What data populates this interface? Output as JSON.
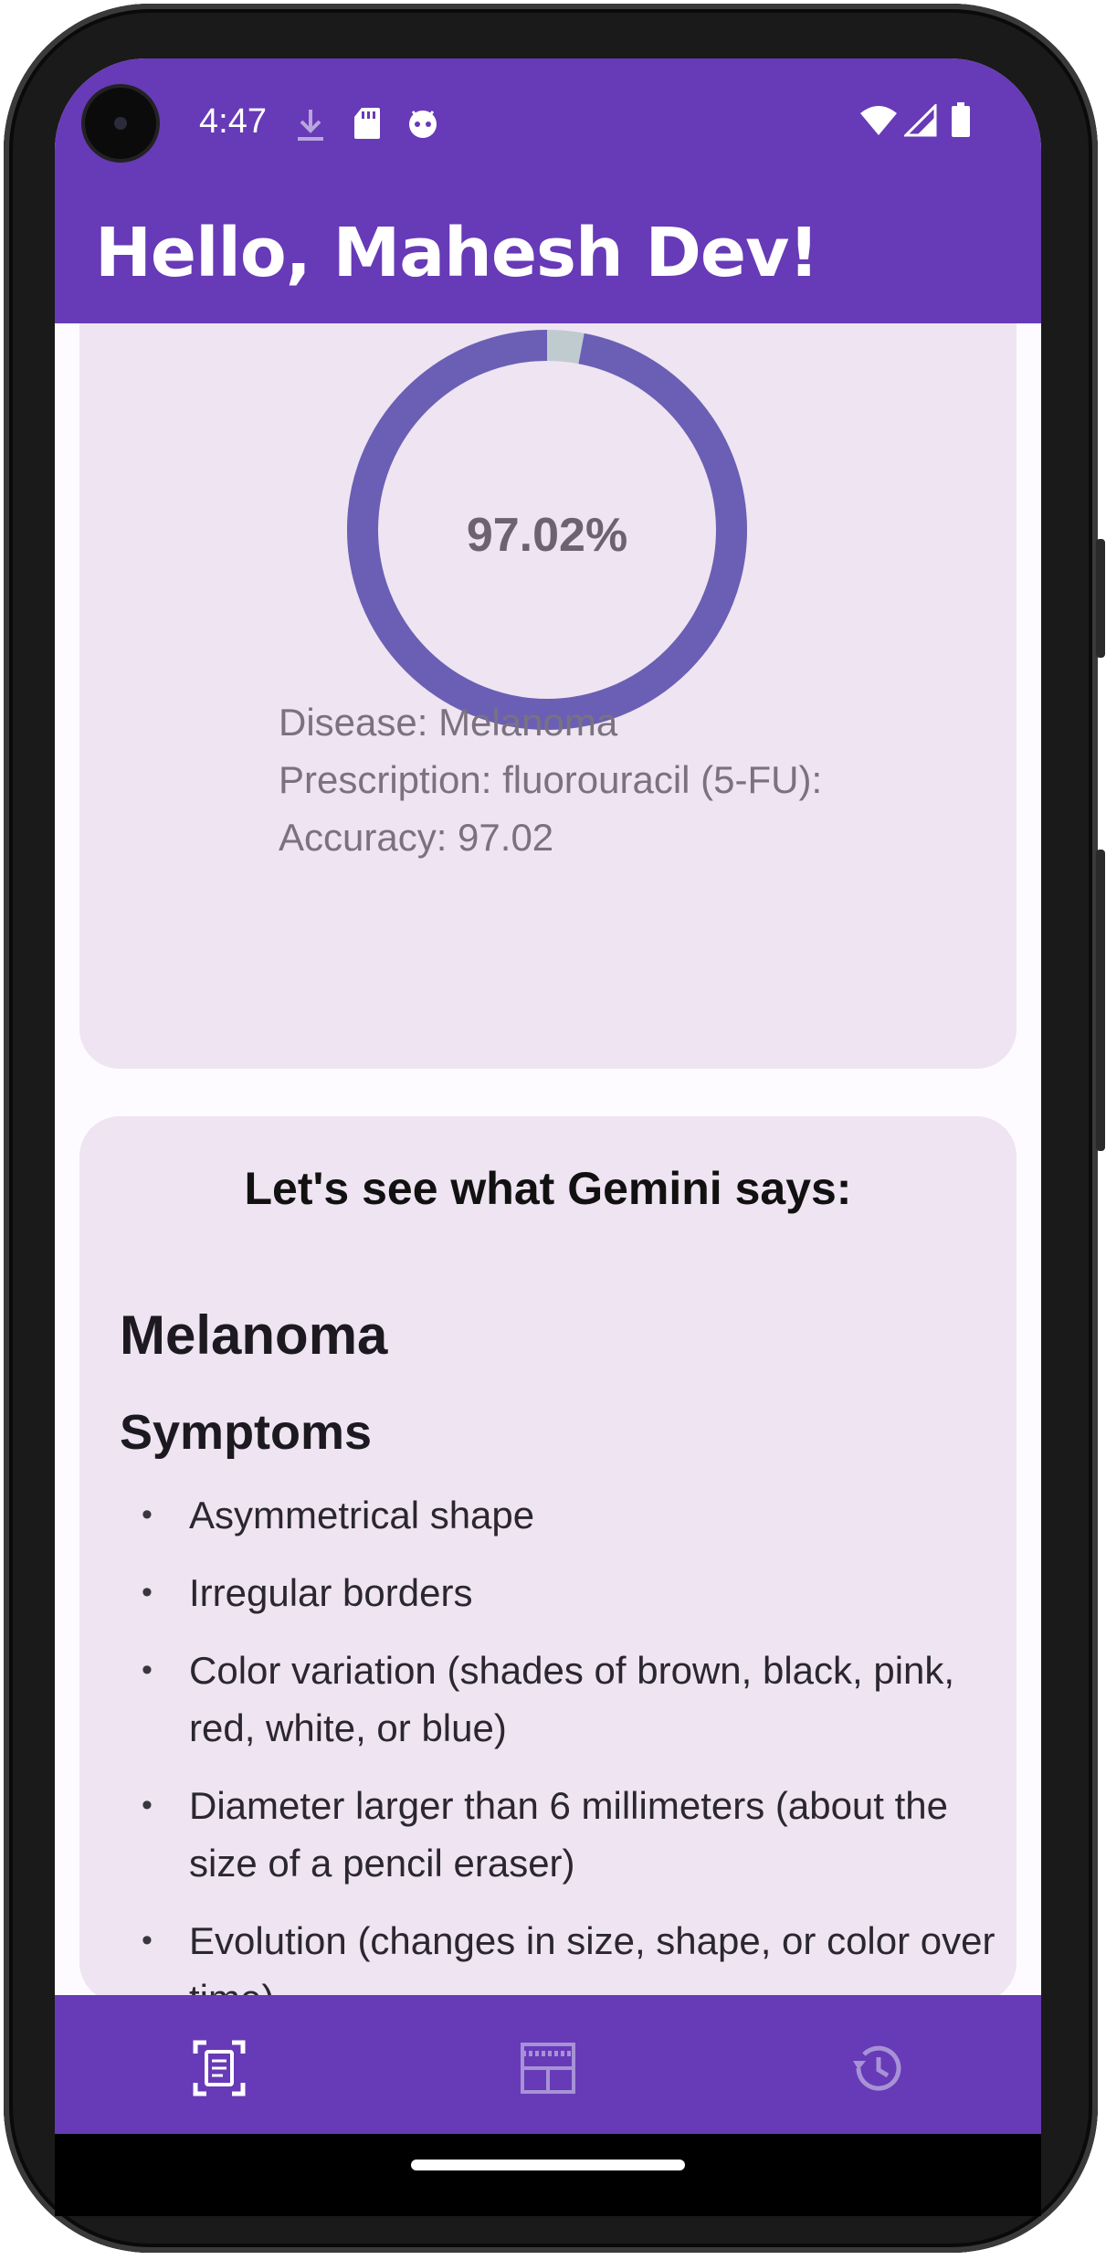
{
  "status_bar": {
    "time": "4:47",
    "icons": [
      "download-icon",
      "sd-card-icon",
      "android-debug-icon",
      "wifi-icon",
      "signal-icon",
      "battery-icon"
    ]
  },
  "appbar": {
    "title": "Hello, Mahesh Dev!"
  },
  "result_card": {
    "ring_percent_label": "97.02%",
    "ring_fill_percent": 97.02,
    "disease_line": "Disease: Melanoma",
    "prescription_line": "Prescription: fluorouracil (5-FU):",
    "accuracy_line": "Accuracy: 97.02"
  },
  "gemini_card": {
    "title": "Let's see what Gemini says:",
    "heading": "Melanoma",
    "subheading": "Symptoms",
    "symptoms": [
      "Asymmetrical shape",
      "Irregular borders",
      "Color variation (shades of brown, black, pink, red, white, or blue)",
      "Diameter larger than 6 millimeters (about the size of a pencil eraser)",
      "Evolution (changes in size, shape, or color over time)"
    ]
  },
  "bottom_nav": {
    "items": [
      {
        "icon": "document-scan-icon",
        "active": true
      },
      {
        "icon": "dashboard-icon",
        "active": false
      },
      {
        "icon": "history-icon",
        "active": false
      }
    ]
  },
  "colors": {
    "primary": "#673ab7",
    "card_bg": "#efe4f1",
    "ring": "#6a5fb5",
    "ring_remainder": "#c0cbd0"
  }
}
